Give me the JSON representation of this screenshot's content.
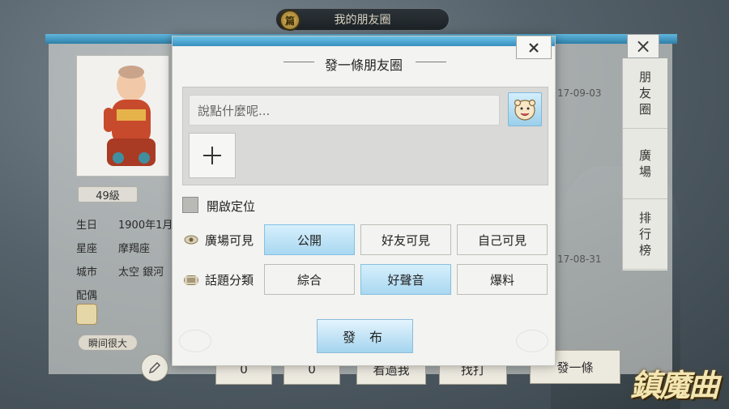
{
  "background": {
    "top_title": "我的朋友圈",
    "top_badge": "篇",
    "side_tabs": [
      "朋友圈",
      "廣場",
      "排行榜"
    ],
    "level": "49級",
    "profile": [
      {
        "key": "生日",
        "value": "1900年1月"
      },
      {
        "key": "星座",
        "value": "摩羯座"
      },
      {
        "key": "城市",
        "value": "太空 銀河"
      },
      {
        "key": "配偶",
        "value": ""
      }
    ],
    "tag": "瞬间很大",
    "dates": [
      "17-09-03",
      "17-08-31"
    ],
    "bottom": {
      "like_count_1": "0",
      "like_count_2": "0",
      "visitors_label": "看過我",
      "find_label": "找打",
      "post_label": "發一條"
    },
    "logo": "鎮魔曲"
  },
  "modal": {
    "title": "發一條朋友圈",
    "close_glyph": "×",
    "input_placeholder": "說點什麼呢...",
    "add_glyph": "+",
    "location_label": "開啟定位",
    "visibility": {
      "label": "廣場可見",
      "options": [
        "公開",
        "好友可見",
        "自己可見"
      ],
      "selected": "公開"
    },
    "topic": {
      "label": "話題分類",
      "options": [
        "綜合",
        "好聲音",
        "爆料"
      ],
      "selected": "好聲音"
    },
    "publish_label": "發 布"
  },
  "colors": {
    "accent": "#69c3e8",
    "selected_option": "#a9d8f1"
  }
}
